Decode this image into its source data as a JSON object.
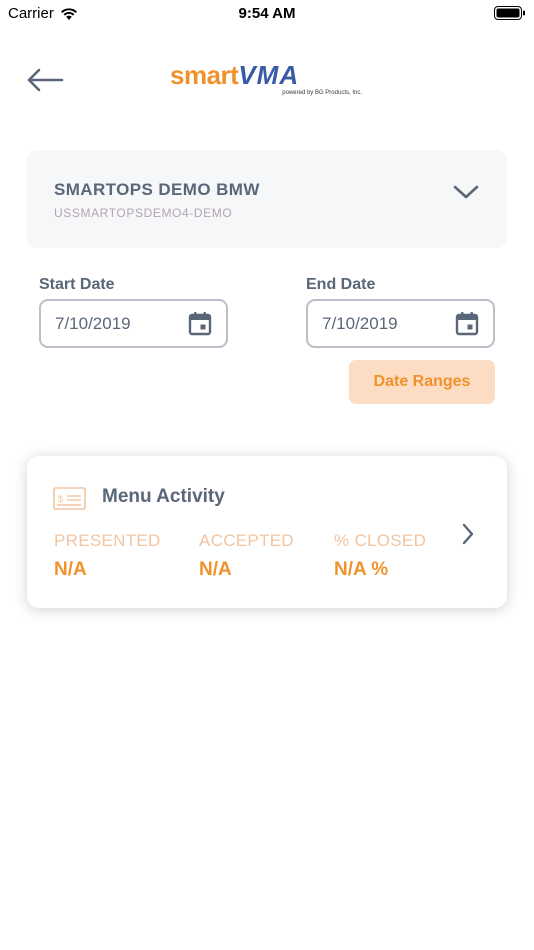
{
  "status_bar": {
    "carrier": "Carrier",
    "time": "9:54 AM"
  },
  "header": {
    "logo_smart": "smart",
    "logo_vma": "VMA",
    "logo_tagline": "powered by BG Products, Inc."
  },
  "dealer": {
    "name": "SMARTOPS DEMO BMW",
    "code": "USSMARTOPSDEMO4-DEMO"
  },
  "dates": {
    "start_label": "Start Date",
    "start_value": "7/10/2019",
    "end_label": "End Date",
    "end_value": "7/10/2019",
    "ranges_button": "Date Ranges"
  },
  "menu_activity": {
    "title": "Menu Activity",
    "stats": [
      {
        "label": "PRESENTED",
        "value": "N/A"
      },
      {
        "label": "ACCEPTED",
        "value": "N/A"
      },
      {
        "label": "% CLOSED",
        "value": "N/A %"
      }
    ]
  },
  "colors": {
    "accent_orange": "#f0922b",
    "text_slate": "#5a6779",
    "brand_blue": "#3a5aa5",
    "button_peach": "#fcdcc3"
  },
  "icons": [
    "wifi-icon",
    "battery-icon",
    "back-arrow-icon",
    "chevron-down-icon",
    "calendar-icon",
    "check-icon",
    "chevron-right-icon"
  ]
}
